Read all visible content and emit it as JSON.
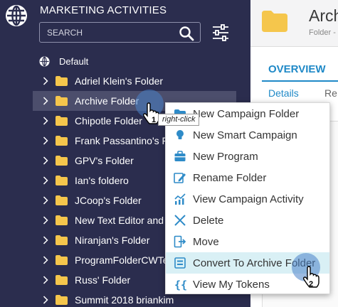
{
  "sidebar": {
    "title": "MARKETING ACTIVITIES",
    "search_placeholder": "SEARCH",
    "root_label": "Default",
    "items": [
      {
        "label": "Adriel Klein's Folder"
      },
      {
        "label": "Archive Folder",
        "selected": true
      },
      {
        "label": "Chipotle Folder"
      },
      {
        "label": "Frank Passantino's Fo"
      },
      {
        "label": "GPV's Folder"
      },
      {
        "label": "Ian's foldero"
      },
      {
        "label": "JCoop's Folder"
      },
      {
        "label": "New Text Editor and"
      },
      {
        "label": "Niranjan's Folder"
      },
      {
        "label": "ProgramFolderCWTe"
      },
      {
        "label": "Russ' Folder"
      },
      {
        "label": "Summit 2018 briankim"
      }
    ]
  },
  "right_panel": {
    "title": "Archi",
    "subtitle": "Folder -",
    "tab_overview": "OVERVIEW",
    "tab_details": "Details",
    "tab_re": "Re",
    "bold_fragment": "r"
  },
  "context_menu": {
    "items": [
      {
        "label": "New Campaign Folder",
        "icon": "folder-icon"
      },
      {
        "label": "New Smart Campaign",
        "icon": "lightbulb-icon"
      },
      {
        "label": "New Program",
        "icon": "briefcase-icon"
      },
      {
        "label": "Rename Folder",
        "icon": "pencil-icon"
      },
      {
        "label": "View Campaign Activity",
        "icon": "bar-chart-icon"
      },
      {
        "label": "Delete",
        "icon": "x-icon"
      },
      {
        "label": "Move",
        "icon": "move-icon"
      },
      {
        "label": "Convert To Archive Folder",
        "icon": "archive-icon",
        "highlighted": true
      },
      {
        "label": "View My Tokens",
        "icon": "braces-icon"
      }
    ]
  },
  "annotations": {
    "step1_number": "1",
    "step1_label": "right-click",
    "step2_number": "2"
  },
  "colors": {
    "sidebar_bg": "#2b2d4e",
    "selected_row": "#4c4e6c",
    "folder_yellow": "#f5c64c",
    "accent_blue": "#1f89c7",
    "menu_highlight": "#d9f0f5",
    "icon_blue": "#2e8bc8"
  }
}
